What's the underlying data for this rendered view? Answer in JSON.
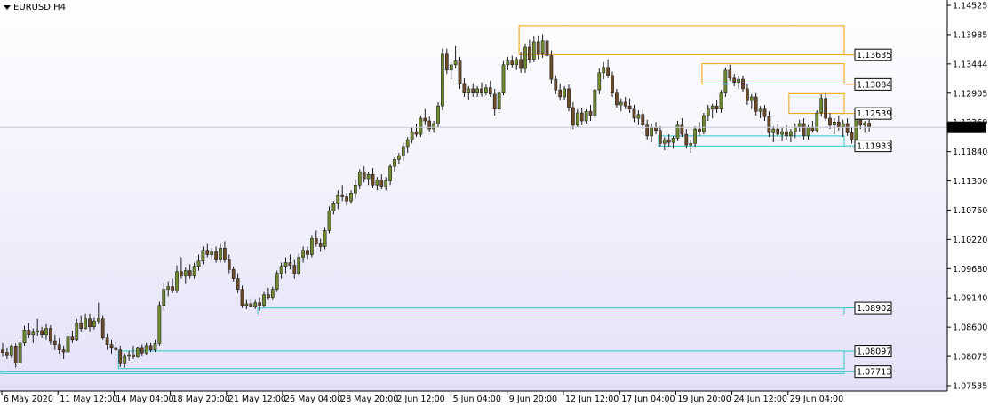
{
  "window": {
    "symbol": "EURUSD,H4"
  },
  "colors": {
    "background_top": "#ffffff",
    "background_bottom": "#e4e2f8",
    "bull_candle": "#6e8a2d",
    "bear_candle": "#6b4a2a",
    "wick": "#1a1a1a",
    "supply_zone": "#f0a000",
    "demand_zone": "#30c8c8",
    "current_price_bg": "#000000"
  },
  "chart_data": {
    "type": "candlestick",
    "title": "EURUSD,H4",
    "ylim": [
      1.0745,
      1.1456
    ],
    "price_ticks": [
      "1.14525",
      "1.13985",
      "1.13444",
      "1.12905",
      "1.12360",
      "1.11840",
      "1.11300",
      "1.10760",
      "1.10220",
      "1.09680",
      "1.09140",
      "1.08600",
      "1.08075",
      "1.07535"
    ],
    "time_ticks": [
      "6 May 2020",
      "11 May 12:00",
      "14 May 04:00",
      "18 May 20:00",
      "21 May 12:00",
      "26 May 04:00",
      "28 May 20:00",
      "2 Jun 12:00",
      "5 Jun 04:00",
      "9 Jun 20:00",
      "12 Jun 12:00",
      "17 Jun 04:00",
      "19 Jun 20:00",
      "24 Jun 12:00",
      "29 Jun 04:00"
    ],
    "current_price": "1.12281",
    "key_levels": [
      {
        "label": "1.13635",
        "kind": "supply",
        "top": 1.1418,
        "bottom": 1.1364,
        "start_bar": 119
      },
      {
        "label": "1.13084",
        "kind": "supply",
        "top": 1.1347,
        "bottom": 1.1309,
        "start_bar": 161
      },
      {
        "label": "1.12539",
        "kind": "supply",
        "top": 1.1291,
        "bottom": 1.1254,
        "start_bar": 181
      },
      {
        "label": "1.11933",
        "kind": "demand",
        "top": 1.1212,
        "bottom": 1.1193,
        "start_bar": 151
      },
      {
        "label": "1.08902",
        "kind": "demand",
        "top": 1.089,
        "bottom": 1.0877,
        "start_bar": 59
      },
      {
        "label": "1.08097",
        "kind": "demand",
        "top": 1.081,
        "bottom": 1.0777,
        "start_bar": 27
      },
      {
        "label": "1.07713",
        "kind": "demand",
        "top": 1.0771,
        "bottom": 1.0769,
        "start_bar": 0
      }
    ],
    "ohlc": [
      [
        1.0812,
        1.0825,
        1.0799,
        1.0807
      ],
      [
        1.0807,
        1.0815,
        1.0795,
        1.0801
      ],
      [
        1.0801,
        1.0822,
        1.0797,
        1.0819
      ],
      [
        1.0819,
        1.0824,
        1.0779,
        1.0787
      ],
      [
        1.0787,
        1.083,
        1.0783,
        1.0825
      ],
      [
        1.0825,
        1.0857,
        1.082,
        1.0849
      ],
      [
        1.0849,
        1.0862,
        1.0835,
        1.084
      ],
      [
        1.084,
        1.0852,
        1.0825,
        1.0845
      ],
      [
        1.0845,
        1.087,
        1.0838,
        1.0848
      ],
      [
        1.0848,
        1.0855,
        1.0835,
        1.084
      ],
      [
        1.084,
        1.086,
        1.083,
        1.0852
      ],
      [
        1.0852,
        1.0858,
        1.0822,
        1.0828
      ],
      [
        1.0828,
        1.084,
        1.0812,
        1.0822
      ],
      [
        1.0822,
        1.0835,
        1.0805,
        1.0812
      ],
      [
        1.0812,
        1.082,
        1.0795,
        1.0808
      ],
      [
        1.0808,
        1.0842,
        1.0805,
        1.0837
      ],
      [
        1.0837,
        1.0848,
        1.0825,
        1.083
      ],
      [
        1.083,
        1.087,
        1.0828,
        1.0862
      ],
      [
        1.0862,
        1.0875,
        1.0845,
        1.0852
      ],
      [
        1.0852,
        1.088,
        1.085,
        1.087
      ],
      [
        1.087,
        1.088,
        1.0845,
        1.0855
      ],
      [
        1.0855,
        1.0872,
        1.085,
        1.0866
      ],
      [
        1.0866,
        1.09,
        1.086,
        1.087
      ],
      [
        1.087,
        1.0875,
        1.083,
        1.0835
      ],
      [
        1.0835,
        1.0842,
        1.0812,
        1.0822
      ],
      [
        1.0822,
        1.083,
        1.0805,
        1.0815
      ],
      [
        1.0815,
        1.0826,
        1.08,
        1.0812
      ],
      [
        1.0812,
        1.082,
        1.078,
        1.0786
      ],
      [
        1.0786,
        1.0805,
        1.0779,
        1.08
      ],
      [
        1.08,
        1.081,
        1.0792,
        1.0803
      ],
      [
        1.0803,
        1.082,
        1.0795,
        1.0799
      ],
      [
        1.0799,
        1.0818,
        1.0797,
        1.0815
      ],
      [
        1.0815,
        1.0822,
        1.08,
        1.0806
      ],
      [
        1.0806,
        1.0825,
        1.0802,
        1.082
      ],
      [
        1.082,
        1.0825,
        1.0808,
        1.0812
      ],
      [
        1.0812,
        1.083,
        1.0808,
        1.0824
      ],
      [
        1.0824,
        1.0902,
        1.082,
        1.0895
      ],
      [
        1.0895,
        1.0938,
        1.0885,
        1.0925
      ],
      [
        1.0925,
        1.094,
        1.0912,
        1.093
      ],
      [
        1.093,
        1.0945,
        1.0918,
        1.0922
      ],
      [
        1.0922,
        1.097,
        1.0918,
        1.0958
      ],
      [
        1.0958,
        1.0985,
        1.0945,
        1.095
      ],
      [
        1.095,
        1.0966,
        1.0935,
        1.096
      ],
      [
        1.096,
        1.0972,
        1.0945,
        1.095
      ],
      [
        1.095,
        1.0975,
        1.0945,
        1.0968
      ],
      [
        1.0968,
        1.099,
        1.096,
        1.0978
      ],
      [
        1.0978,
        1.1005,
        1.0972,
        1.0998
      ],
      [
        1.0998,
        1.101,
        1.0985,
        1.099
      ],
      [
        1.099,
        1.1002,
        1.098,
        1.0995
      ],
      [
        1.0995,
        1.1005,
        1.0975,
        1.098
      ],
      [
        1.098,
        1.101,
        1.0975,
        1.1002
      ],
      [
        1.1002,
        1.1015,
        1.0975,
        1.098
      ],
      [
        1.098,
        1.099,
        1.0955,
        1.0962
      ],
      [
        1.0962,
        1.0968,
        1.094,
        1.0945
      ],
      [
        1.0945,
        1.0955,
        1.0918,
        1.0925
      ],
      [
        1.0925,
        1.0932,
        1.089,
        1.0895
      ],
      [
        1.0895,
        1.0905,
        1.0888,
        1.0898
      ],
      [
        1.0898,
        1.0908,
        1.089,
        1.0893
      ],
      [
        1.0893,
        1.0905,
        1.0888,
        1.09
      ],
      [
        1.09,
        1.091,
        1.0885,
        1.0895
      ],
      [
        1.0895,
        1.092,
        1.0892,
        1.0915
      ],
      [
        1.0915,
        1.0928,
        1.0905,
        1.091
      ],
      [
        1.091,
        1.093,
        1.0905,
        1.0925
      ],
      [
        1.0925,
        1.096,
        1.092,
        1.0955
      ],
      [
        1.0955,
        1.0975,
        1.0945,
        1.0968
      ],
      [
        1.0968,
        1.0985,
        1.0955,
        1.0975
      ],
      [
        1.0975,
        1.099,
        1.0962,
        1.097
      ],
      [
        1.097,
        1.098,
        1.0945,
        1.0955
      ],
      [
        1.0955,
        1.0992,
        1.095,
        1.0985
      ],
      [
        1.0985,
        1.1005,
        1.0975,
        1.0998
      ],
      [
        1.0998,
        1.1005,
        1.098,
        1.099
      ],
      [
        1.099,
        1.1025,
        1.0985,
        1.102
      ],
      [
        1.102,
        1.1035,
        1.1005,
        1.101
      ],
      [
        1.101,
        1.102,
        1.0995,
        1.1005
      ],
      [
        1.1005,
        1.104,
        1.1,
        1.1035
      ],
      [
        1.1035,
        1.108,
        1.103,
        1.1072
      ],
      [
        1.1072,
        1.109,
        1.1065,
        1.1085
      ],
      [
        1.1085,
        1.111,
        1.1075,
        1.1102
      ],
      [
        1.1102,
        1.112,
        1.109,
        1.1098
      ],
      [
        1.1098,
        1.1105,
        1.1082,
        1.109
      ],
      [
        1.109,
        1.111,
        1.1085,
        1.1105
      ],
      [
        1.1105,
        1.113,
        1.1095,
        1.112
      ],
      [
        1.112,
        1.115,
        1.1112,
        1.1145
      ],
      [
        1.1145,
        1.1155,
        1.1125,
        1.1132
      ],
      [
        1.1132,
        1.1145,
        1.112,
        1.114
      ],
      [
        1.114,
        1.1152,
        1.1115,
        1.112
      ],
      [
        1.112,
        1.1135,
        1.111,
        1.113
      ],
      [
        1.113,
        1.114,
        1.1112,
        1.1118
      ],
      [
        1.1118,
        1.1135,
        1.111,
        1.1128
      ],
      [
        1.1128,
        1.116,
        1.112,
        1.1155
      ],
      [
        1.1155,
        1.1172,
        1.1145,
        1.1168
      ],
      [
        1.1168,
        1.118,
        1.116,
        1.1175
      ],
      [
        1.1175,
        1.12,
        1.1165,
        1.1192
      ],
      [
        1.1192,
        1.121,
        1.118,
        1.1205
      ],
      [
        1.1205,
        1.1228,
        1.1198,
        1.122
      ],
      [
        1.122,
        1.1235,
        1.121,
        1.1215
      ],
      [
        1.1215,
        1.125,
        1.121,
        1.1245
      ],
      [
        1.1245,
        1.1262,
        1.1232,
        1.124
      ],
      [
        1.124,
        1.1248,
        1.122,
        1.1225
      ],
      [
        1.1225,
        1.124,
        1.1218,
        1.1235
      ],
      [
        1.1235,
        1.1275,
        1.1228,
        1.1268
      ],
      [
        1.1268,
        1.1375,
        1.126,
        1.1365
      ],
      [
        1.1365,
        1.1375,
        1.1328,
        1.1335
      ],
      [
        1.1335,
        1.135,
        1.1318,
        1.1345
      ],
      [
        1.1345,
        1.138,
        1.1338,
        1.1352
      ],
      [
        1.1352,
        1.136,
        1.13,
        1.131
      ],
      [
        1.131,
        1.132,
        1.1285,
        1.1292
      ],
      [
        1.1292,
        1.1305,
        1.128,
        1.13
      ],
      [
        1.13,
        1.131,
        1.1285,
        1.1292
      ],
      [
        1.1292,
        1.1305,
        1.1285,
        1.13
      ],
      [
        1.13,
        1.1312,
        1.1285,
        1.1292
      ],
      [
        1.1292,
        1.1308,
        1.1288,
        1.1302
      ],
      [
        1.1302,
        1.1315,
        1.1285,
        1.129
      ],
      [
        1.129,
        1.13,
        1.125,
        1.1262
      ],
      [
        1.1262,
        1.1298,
        1.1255,
        1.1292
      ],
      [
        1.1292,
        1.1352,
        1.1288,
        1.1345
      ],
      [
        1.1345,
        1.136,
        1.1335,
        1.1352
      ],
      [
        1.1352,
        1.1362,
        1.134,
        1.1345
      ],
      [
        1.1345,
        1.136,
        1.1335,
        1.1355
      ],
      [
        1.1355,
        1.137,
        1.133,
        1.1338
      ],
      [
        1.1338,
        1.1385,
        1.133,
        1.1378
      ],
      [
        1.1378,
        1.1392,
        1.1348,
        1.1355
      ],
      [
        1.1355,
        1.1398,
        1.135,
        1.1388
      ],
      [
        1.1388,
        1.14,
        1.1355,
        1.1365
      ],
      [
        1.1365,
        1.1402,
        1.1358,
        1.139
      ],
      [
        1.139,
        1.1395,
        1.1355,
        1.1362
      ],
      [
        1.1362,
        1.1372,
        1.131,
        1.1318
      ],
      [
        1.1318,
        1.1325,
        1.129,
        1.1298
      ],
      [
        1.1298,
        1.131,
        1.1278,
        1.1285
      ],
      [
        1.1285,
        1.1305,
        1.128,
        1.13
      ],
      [
        1.13,
        1.1308,
        1.1258,
        1.1265
      ],
      [
        1.1265,
        1.1275,
        1.1225,
        1.1232
      ],
      [
        1.1232,
        1.1262,
        1.1228,
        1.1255
      ],
      [
        1.1255,
        1.1265,
        1.1232,
        1.124
      ],
      [
        1.124,
        1.1262,
        1.1235,
        1.1258
      ],
      [
        1.1258,
        1.127,
        1.124,
        1.125
      ],
      [
        1.125,
        1.1305,
        1.1245,
        1.1298
      ],
      [
        1.1298,
        1.1338,
        1.129,
        1.133
      ],
      [
        1.133,
        1.135,
        1.1318,
        1.134
      ],
      [
        1.134,
        1.1355,
        1.132,
        1.1325
      ],
      [
        1.1325,
        1.1332,
        1.1285,
        1.1292
      ],
      [
        1.1292,
        1.13,
        1.1265,
        1.127
      ],
      [
        1.127,
        1.1282,
        1.1258,
        1.1275
      ],
      [
        1.1275,
        1.1285,
        1.1262,
        1.1268
      ],
      [
        1.1268,
        1.1282,
        1.1255,
        1.1262
      ],
      [
        1.1262,
        1.127,
        1.1238,
        1.1245
      ],
      [
        1.1245,
        1.126,
        1.1232,
        1.1252
      ],
      [
        1.1252,
        1.1262,
        1.1225,
        1.1232
      ],
      [
        1.1232,
        1.1242,
        1.1205,
        1.1212
      ],
      [
        1.1212,
        1.1235,
        1.12,
        1.1228
      ],
      [
        1.1228,
        1.1238,
        1.1215,
        1.1222
      ],
      [
        1.1222,
        1.123,
        1.1192,
        1.1198
      ],
      [
        1.1198,
        1.121,
        1.1185,
        1.1205
      ],
      [
        1.1205,
        1.1215,
        1.1192,
        1.12
      ],
      [
        1.12,
        1.1212,
        1.1188,
        1.1208
      ],
      [
        1.1208,
        1.124,
        1.1202,
        1.1232
      ],
      [
        1.1232,
        1.1245,
        1.121,
        1.1215
      ],
      [
        1.1215,
        1.1225,
        1.1188,
        1.1195
      ],
      [
        1.1195,
        1.1205,
        1.118,
        1.1198
      ],
      [
        1.1198,
        1.123,
        1.1192,
        1.1225
      ],
      [
        1.1225,
        1.1238,
        1.1212,
        1.122
      ],
      [
        1.122,
        1.1255,
        1.1215,
        1.125
      ],
      [
        1.125,
        1.127,
        1.124,
        1.1262
      ],
      [
        1.1262,
        1.1272,
        1.1245,
        1.1268
      ],
      [
        1.1268,
        1.128,
        1.1255,
        1.1262
      ],
      [
        1.1262,
        1.1298,
        1.1255,
        1.1292
      ],
      [
        1.1292,
        1.134,
        1.1285,
        1.1335
      ],
      [
        1.1335,
        1.1345,
        1.1315,
        1.132
      ],
      [
        1.132,
        1.1328,
        1.1305,
        1.1312
      ],
      [
        1.1312,
        1.1325,
        1.13,
        1.1318
      ],
      [
        1.1318,
        1.1325,
        1.1295,
        1.13
      ],
      [
        1.13,
        1.131,
        1.127,
        1.1278
      ],
      [
        1.1278,
        1.129,
        1.1262,
        1.1285
      ],
      [
        1.1285,
        1.1292,
        1.125,
        1.1258
      ],
      [
        1.1258,
        1.1268,
        1.1245,
        1.1262
      ],
      [
        1.1262,
        1.127,
        1.124,
        1.1248
      ],
      [
        1.1248,
        1.1258,
        1.121,
        1.1218
      ],
      [
        1.1218,
        1.123,
        1.12,
        1.1225
      ],
      [
        1.1225,
        1.1235,
        1.121,
        1.1215
      ],
      [
        1.1215,
        1.1228,
        1.1202,
        1.122
      ],
      [
        1.122,
        1.1232,
        1.1205,
        1.1212
      ],
      [
        1.1212,
        1.1225,
        1.12,
        1.122
      ],
      [
        1.122,
        1.1235,
        1.1208,
        1.1228
      ],
      [
        1.1228,
        1.1242,
        1.122,
        1.1235
      ],
      [
        1.1235,
        1.1245,
        1.1205,
        1.1212
      ],
      [
        1.1212,
        1.1232,
        1.1205,
        1.1228
      ],
      [
        1.1228,
        1.124,
        1.1218,
        1.1222
      ],
      [
        1.1222,
        1.126,
        1.1218,
        1.1255
      ],
      [
        1.1255,
        1.129,
        1.1248,
        1.1282
      ],
      [
        1.1282,
        1.1292,
        1.124,
        1.1245
      ],
      [
        1.1245,
        1.1255,
        1.1225,
        1.1232
      ],
      [
        1.1232,
        1.1245,
        1.1215,
        1.1238
      ],
      [
        1.1238,
        1.125,
        1.1222,
        1.1228
      ],
      [
        1.1228,
        1.1242,
        1.121,
        1.1235
      ],
      [
        1.1235,
        1.1245,
        1.1212,
        1.1218
      ],
      [
        1.1218,
        1.1228,
        1.1198,
        1.1205
      ],
      [
        1.1205,
        1.125,
        1.12,
        1.1245
      ],
      [
        1.1245,
        1.1252,
        1.1225,
        1.1232
      ],
      [
        1.1232,
        1.124,
        1.1218,
        1.1236
      ],
      [
        1.1236,
        1.1242,
        1.122,
        1.1228
      ]
    ]
  }
}
